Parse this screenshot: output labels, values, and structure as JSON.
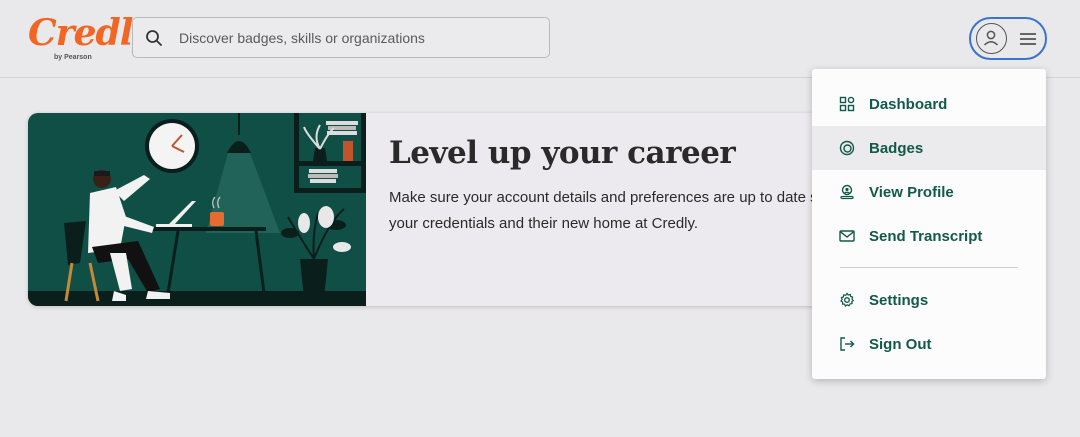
{
  "header": {
    "logo": {
      "word": "Credly",
      "sub": "by Pearson"
    },
    "search": {
      "placeholder": "Discover badges, skills or organizations",
      "icon": "search-icon"
    },
    "account": {
      "avatar_icon": "user-icon",
      "menu_icon": "hamburger-icon",
      "focus_color": "#3a73d1"
    }
  },
  "banner": {
    "title": "Level up your career",
    "text": "Make sure your account details and preferences are up to date so you can get the most out of your credentials and their new home at Credly."
  },
  "dropdown": {
    "items": [
      {
        "label": "Dashboard",
        "icon": "dashboard-grid-icon"
      },
      {
        "label": "Badges",
        "icon": "badge-icon",
        "hovered": true
      },
      {
        "label": "View Profile",
        "icon": "profile-icon"
      },
      {
        "label": "Send Transcript",
        "icon": "envelope-icon"
      },
      {
        "label": "Settings",
        "icon": "gear-icon"
      },
      {
        "label": "Sign Out",
        "icon": "sign-out-icon"
      }
    ]
  },
  "colors": {
    "brand_orange": "#f26522",
    "menu_text": "#12594a",
    "illustration_bg": "#0f4f46"
  }
}
